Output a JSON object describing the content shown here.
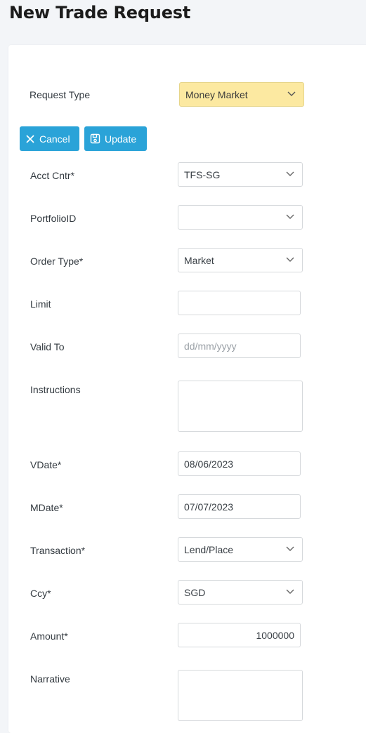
{
  "header": {
    "title": "New Trade Request"
  },
  "request_type": {
    "label": "Request Type",
    "value": "Money Market"
  },
  "toolbar": {
    "cancel_label": "Cancel",
    "update_label": "Update"
  },
  "form": {
    "acct_cntr": {
      "label": "Acct Cntr*",
      "value": "TFS-SG"
    },
    "portfolio_id": {
      "label": "PortfolioID",
      "value": ""
    },
    "order_type": {
      "label": "Order Type*",
      "value": "Market"
    },
    "limit": {
      "label": "Limit",
      "value": ""
    },
    "valid_to": {
      "label": "Valid To",
      "placeholder": "dd/mm/yyyy"
    },
    "instructions": {
      "label": "Instructions",
      "value": ""
    },
    "vdate": {
      "label": "VDate*",
      "value": "08/06/2023"
    },
    "mdate": {
      "label": "MDate*",
      "value": "07/07/2023"
    },
    "transaction": {
      "label": "Transaction*",
      "value": "Lend/Place"
    },
    "ccy": {
      "label": "Ccy*",
      "value": "SGD"
    },
    "amount": {
      "label": "Amount*",
      "value": "1000000"
    },
    "narrative": {
      "label": "Narrative",
      "value": ""
    }
  },
  "colors": {
    "accent": "#2aa3d8",
    "request_type_bg": "#fce9a1",
    "page_bg": "#f3f5f8"
  },
  "icons": {
    "cancel": "close-icon",
    "update": "save-icon",
    "dropdown": "chevron-down-icon"
  }
}
